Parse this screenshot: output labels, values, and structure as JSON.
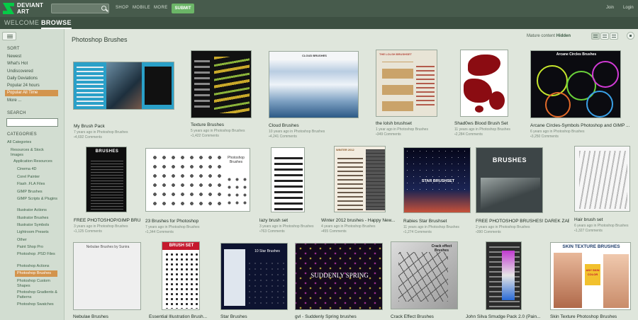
{
  "header": {
    "logo_line1": "DEVIANT",
    "logo_line2": "ART",
    "nav": [
      "SHOP",
      "MOBILE",
      "MORE"
    ],
    "submit_label": "SUBMIT",
    "join_label": "Join",
    "login_label": "Login"
  },
  "tabs": [
    "WELCOME",
    "BROWSE"
  ],
  "sidebar": {
    "sort_heading": "SORT",
    "sort_items": [
      "Newest",
      "What's Hot",
      "Undiscovered",
      "Daily Deviations",
      "Popular 24 hours",
      "Popular All Time",
      "More ..."
    ],
    "search_heading": "SEARCH",
    "categories_heading": "CATEGORIES",
    "categories": [
      "All Categories",
      "Resources & Stock Images",
      "Application Resources",
      "Cinema 4D",
      "Corel Painter",
      "Flash .FLA Files",
      "GIMP Brushes",
      "GIMP Scripts & Plugins",
      "Illustrator Actions",
      "Illustrator Brushes",
      "Illustrator Symbols",
      "Lightroom Presets",
      "Other",
      "Paint Shop Pro",
      "Photoshop .PSD Files",
      "Photoshop Actions",
      "Photoshop Brushes",
      "Photoshop Custom Shapes",
      "Photoshop Gradients & Patterns",
      "Photoshop Swatches"
    ]
  },
  "main": {
    "title": "Photoshop Brushes",
    "mature_label": "Mature content",
    "mature_value": "Hidden"
  },
  "items": [
    {
      "title": "My Brush Pack",
      "meta": "7 years ago in Photoshop Brushes",
      "comments": "4,692 Comments"
    },
    {
      "title": "Texture Brushes",
      "meta": "5 years ago in Photoshop Brushes",
      "comments": "1,422 Comments"
    },
    {
      "title": "Cloud Brushes",
      "meta": "10 years ago in Photoshop Brushes",
      "comments": "4,241 Comments"
    },
    {
      "title": "the lolsh brushset",
      "meta": "1 year ago in Photoshop Brushes",
      "comments": "349 Comments"
    },
    {
      "title": "Shad0ws Blood Brush Set",
      "meta": "11 years ago in Photoshop Brushes",
      "comments": "2,284 Comments"
    },
    {
      "title": "Arcane Circles-Symbols Photoshop and GIMP ...",
      "meta": "6 years ago in Photoshop Brushes",
      "comments": "3,250 Comments"
    },
    {
      "title": "FREE PHOTOSHOP/GIMP BRU...",
      "meta": "3 years ago in Photoshop Brushes",
      "comments": "1,125 Comments"
    },
    {
      "title": "23 Brushes for Photoshop",
      "meta": "7 years ago in Photoshop Brushes",
      "comments": "1,344 Comments"
    },
    {
      "title": "lazy brush set",
      "meta": "3 years ago in Photoshop Brushes",
      "comments": "763 Comments"
    },
    {
      "title": "Winter 2012 brushes - Happy New...",
      "meta": "4 years ago in Photoshop Brushes",
      "comments": "455 Comments"
    },
    {
      "title": "Rabies Star Brushset",
      "meta": "11 years ago in Photoshop Brushes",
      "comments": "1,274 Comments"
    },
    {
      "title": "FREE PHOTOSHOP BRUSHES! DAREK ZAB...",
      "meta": "2 years ago in Photoshop Brushes",
      "comments": "390 Comments"
    },
    {
      "title": "Hair brush set",
      "meta": "6 years ago in Photoshop Brushes",
      "comments": "1,327 Comments"
    },
    {
      "title": "Nebulae Brushes",
      "thumb_label": "Nebulae Brushes by Sunira"
    },
    {
      "title": "Essential Illustration Brush...",
      "thumb_label": "BRUSH SET"
    },
    {
      "title": "Star Brushes",
      "thumb_label": "10 Star Brushes"
    },
    {
      "title": "gvl - Suddenly Spring brushes",
      "thumb_label": "SUDDENLY SPRING"
    },
    {
      "title": "Crack Effect Brushes",
      "thumb_label": "Crack effect Brushes"
    },
    {
      "title": "John Silva Smudge Pack 2.0 (Pain..."
    },
    {
      "title": "Skin Texture Photoshop Brushes",
      "thumb_label": "SKIN TEXTURE BRUSHES"
    }
  ],
  "thumb_labels": {
    "cloud": "CLOUD BRUSHES",
    "lolsh": "THE LOLSH BRUSHSET",
    "arcane": "Arcane Circles Brushes",
    "brushes_free": "BRUSHES",
    "photoshop_brushes": "Photoshop Brushes",
    "star_brushset": "STAR BRUSHSET",
    "winter": "WINTER 2012",
    "darek": "BRUSHES",
    "any_skin": "ANY SKIN COLOR"
  }
}
